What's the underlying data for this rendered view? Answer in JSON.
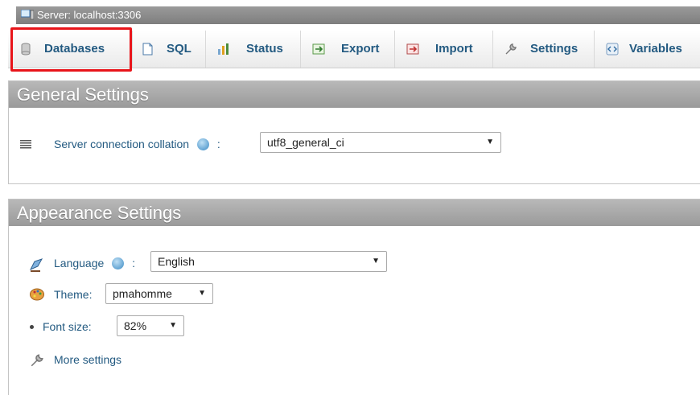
{
  "server": {
    "label": "Server: localhost:3306",
    "icon": "server-icon"
  },
  "tabs": [
    {
      "label": "Databases",
      "icon": "database-icon"
    },
    {
      "label": "SQL",
      "icon": "sql-icon"
    },
    {
      "label": "Status",
      "icon": "status-icon"
    },
    {
      "label": "Export",
      "icon": "export-icon"
    },
    {
      "label": "Import",
      "icon": "import-icon"
    },
    {
      "label": "Settings",
      "icon": "wrench-icon"
    },
    {
      "label": "Variables",
      "icon": "variables-icon"
    }
  ],
  "general": {
    "title": "General Settings",
    "collation_label": "Server connection collation",
    "colon": ":",
    "collation_value": "utf8_general_ci"
  },
  "appearance": {
    "title": "Appearance Settings",
    "language_label": "Language",
    "language_value": "English",
    "colon": ":",
    "theme_label": "Theme:",
    "theme_value": "pmahomme",
    "fontsize_label": "Font size:",
    "fontsize_value": "82%",
    "more_settings": "More settings"
  },
  "colors": {
    "link": "#235a81",
    "highlight": "#e8141a",
    "header_bar": "#9a9a9a"
  }
}
